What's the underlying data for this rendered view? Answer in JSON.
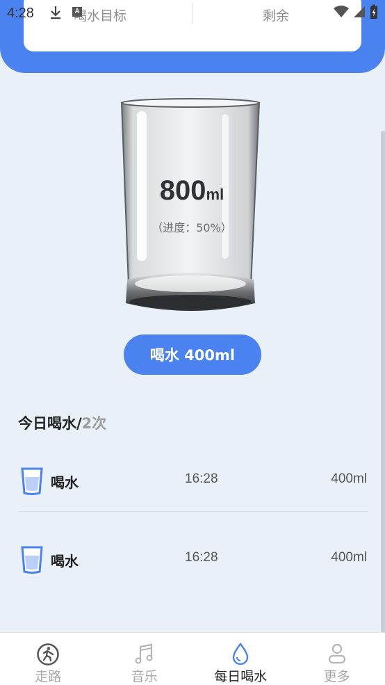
{
  "status_bar": {
    "time": "4:28",
    "notification_a": "A"
  },
  "summary": {
    "goal_label": "喝水目标",
    "remaining_label": "剩余"
  },
  "glass": {
    "amount": "800",
    "unit": "ml",
    "progress_text": "（进度：50%）",
    "progress_fraction": 0.5
  },
  "drink_button": {
    "label": "喝水 400ml"
  },
  "today": {
    "title": "今日喝水/",
    "count": "2次"
  },
  "records": [
    {
      "label": "喝水",
      "time": "16:28",
      "amount": "400ml"
    },
    {
      "label": "喝水",
      "time": "16:28",
      "amount": "400ml"
    }
  ],
  "nav": {
    "items": [
      {
        "label": "走路",
        "icon": "walk-icon"
      },
      {
        "label": "音乐",
        "icon": "music-icon"
      },
      {
        "label": "每日喝水",
        "icon": "water-drop-icon"
      },
      {
        "label": "更多",
        "icon": "person-icon"
      }
    ],
    "active_index": 2
  },
  "colors": {
    "accent": "#4a82ef",
    "background": "#eaf0f8"
  }
}
